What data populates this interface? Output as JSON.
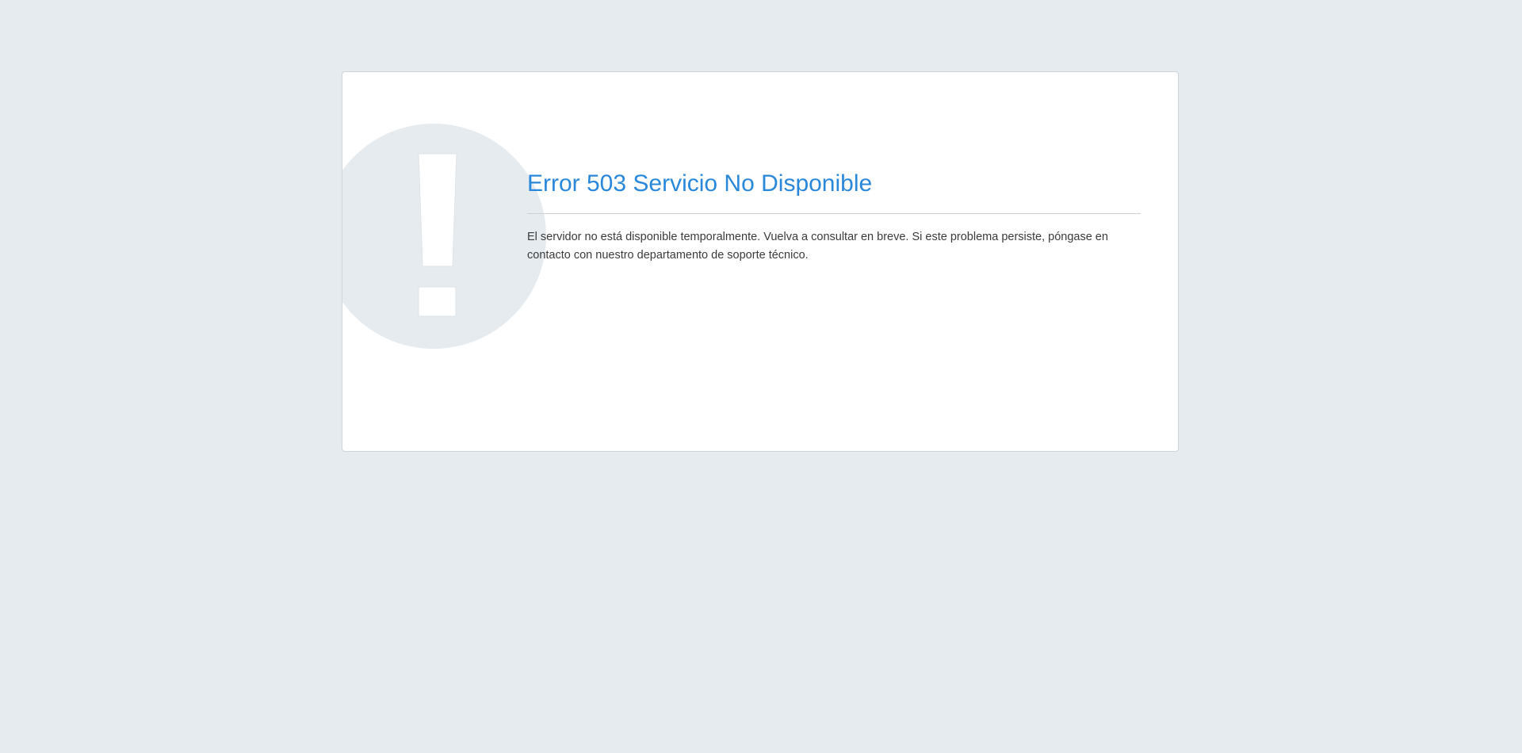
{
  "error_page": {
    "title": "Error 503 Servicio No Disponible",
    "message": "El servidor no está disponible temporalmente. Vuelva a consultar en breve. Si este problema persiste, póngase en contacto con nuestro departamento de soporte técnico.",
    "icon": "exclamation-circle-icon"
  },
  "colors": {
    "page_background": "#e5ebef",
    "card_background": "#ffffff",
    "title": "#2a88da",
    "icon_circle": "#e5ebef",
    "text": "#3a3a3a"
  }
}
